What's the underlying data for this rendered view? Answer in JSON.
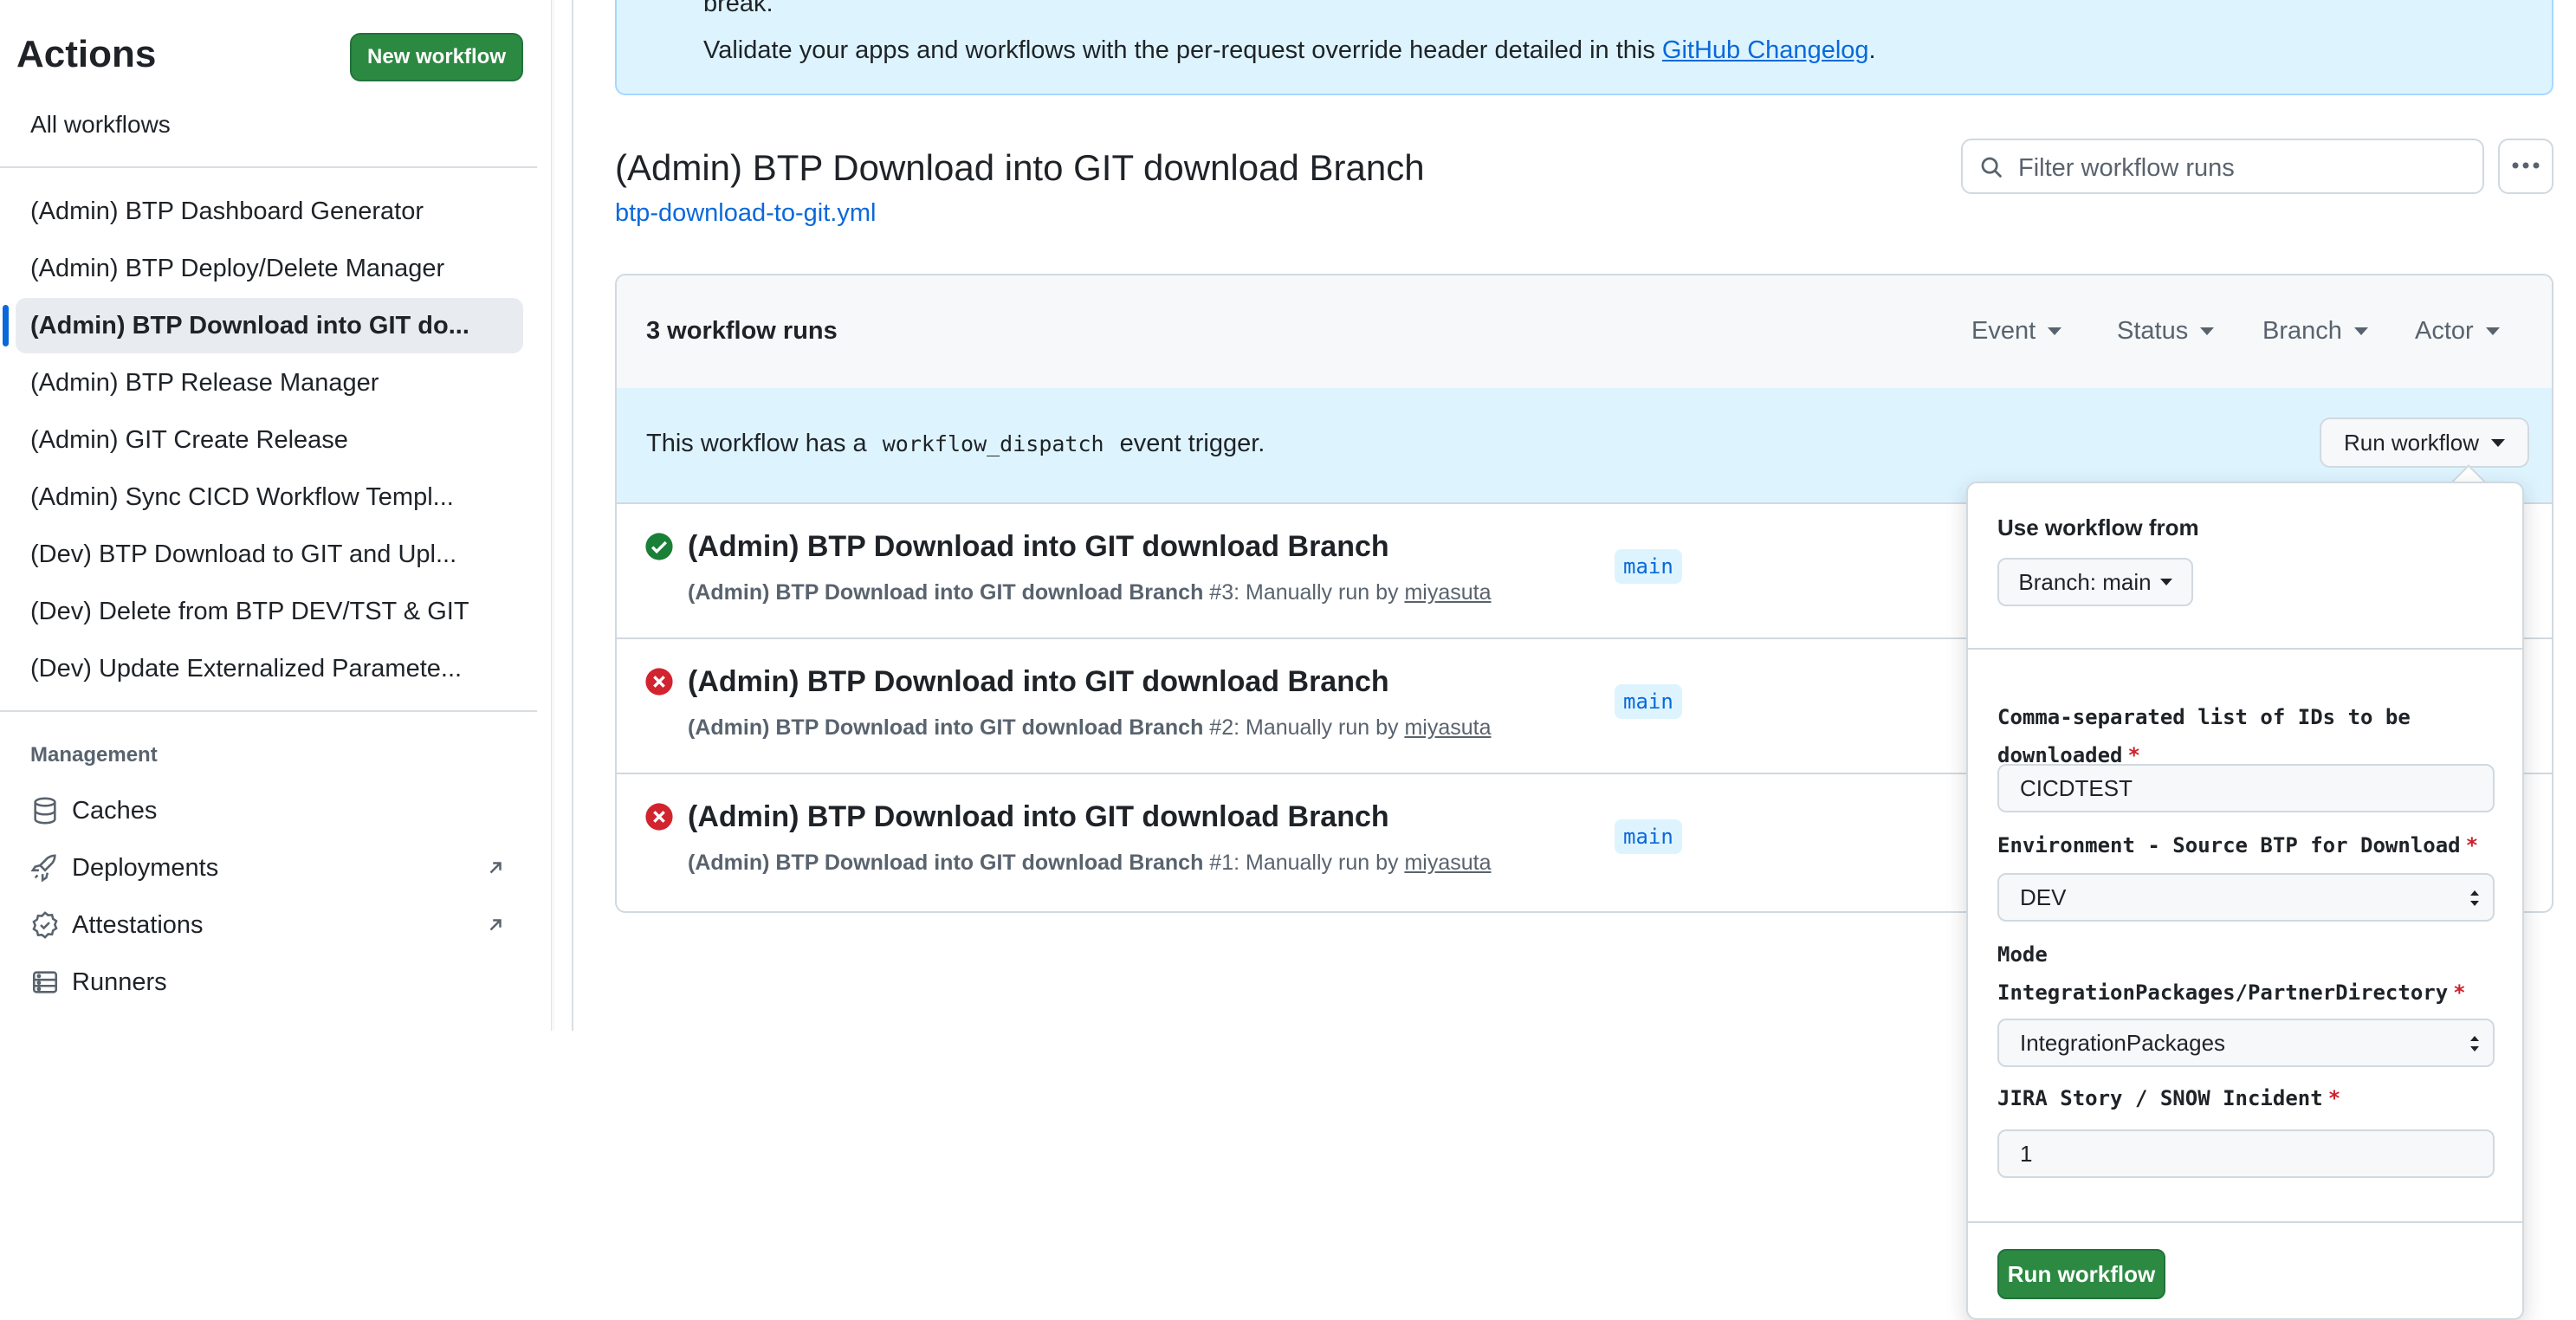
{
  "sidebar": {
    "title": "Actions",
    "new_workflow_label": "New workflow",
    "all_workflows_label": "All workflows",
    "workflows": [
      {
        "label": "(Admin) BTP Dashboard Generator",
        "active": false
      },
      {
        "label": "(Admin) BTP Deploy/Delete Manager",
        "active": false
      },
      {
        "label": "(Admin) BTP Download into GIT do...",
        "active": true
      },
      {
        "label": "(Admin) BTP Release Manager",
        "active": false
      },
      {
        "label": "(Admin) GIT Create Release",
        "active": false
      },
      {
        "label": "(Admin) Sync CICD Workflow Templ...",
        "active": false
      },
      {
        "label": "(Dev) BTP Download to GIT and Upl...",
        "active": false
      },
      {
        "label": "(Dev) Delete from BTP DEV/TST & GIT",
        "active": false
      },
      {
        "label": "(Dev) Update Externalized Paramete...",
        "active": false
      }
    ],
    "management_heading": "Management",
    "management_items": [
      {
        "label": "Caches",
        "icon": "database-icon"
      },
      {
        "label": "Deployments",
        "icon": "rocket-icon",
        "external": true
      },
      {
        "label": "Attestations",
        "icon": "verified-icon",
        "external": true
      },
      {
        "label": "Runners",
        "icon": "server-icon"
      }
    ]
  },
  "banner": {
    "top_fragment": "break.",
    "line_prefix": "Validate your apps and workflows with the per-request override header detailed in this ",
    "link_text": "GitHub Changelog",
    "line_suffix": "."
  },
  "workflow": {
    "title": "(Admin) BTP Download into GIT download Branch",
    "file": "btp-download-to-git.yml"
  },
  "filter": {
    "placeholder": "Filter workflow runs"
  },
  "runs": {
    "count_label": "3 workflow runs",
    "filters": [
      "Event",
      "Status",
      "Branch",
      "Actor"
    ],
    "dispatch_prefix": "This workflow has a",
    "dispatch_code": "workflow_dispatch",
    "dispatch_suffix": "event trigger.",
    "run_workflow_label": "Run workflow",
    "items": [
      {
        "status": "success",
        "title": "(Admin) BTP Download into GIT download Branch",
        "workflow": "(Admin) BTP Download into GIT download Branch",
        "detail": "#3: Manually run by",
        "actor": "miyasuta",
        "branch": "main"
      },
      {
        "status": "failure",
        "title": "(Admin) BTP Download into GIT download Branch",
        "workflow": "(Admin) BTP Download into GIT download Branch",
        "detail": "#2: Manually run by",
        "actor": "miyasuta",
        "branch": "main"
      },
      {
        "status": "failure",
        "title": "(Admin) BTP Download into GIT download Branch",
        "workflow": "(Admin) BTP Download into GIT download Branch",
        "detail": "#1: Manually run by",
        "actor": "miyasuta",
        "branch": "main"
      }
    ]
  },
  "dropdown": {
    "use_from_label": "Use workflow from",
    "branch_label": "Branch: main",
    "field1_label": "Comma-separated list of IDs to be downloaded",
    "field1_value": "CICDTEST",
    "field2_label": "Environment - Source BTP for Download",
    "field2_value": "DEV",
    "field3_label_line1": "Mode",
    "field3_label_line2": "IntegrationPackages/PartnerDirectory",
    "field3_value": "IntegrationPackages",
    "field4_label": "JIRA Story / SNOW Incident",
    "field4_value": "1",
    "required_mark": "*",
    "submit_label": "Run workflow"
  },
  "colors": {
    "primary_button": "#2c8942",
    "link": "#0969da",
    "success": "#1a7f37",
    "failure": "#d1242f",
    "info_bg": "#ddf4ff"
  }
}
